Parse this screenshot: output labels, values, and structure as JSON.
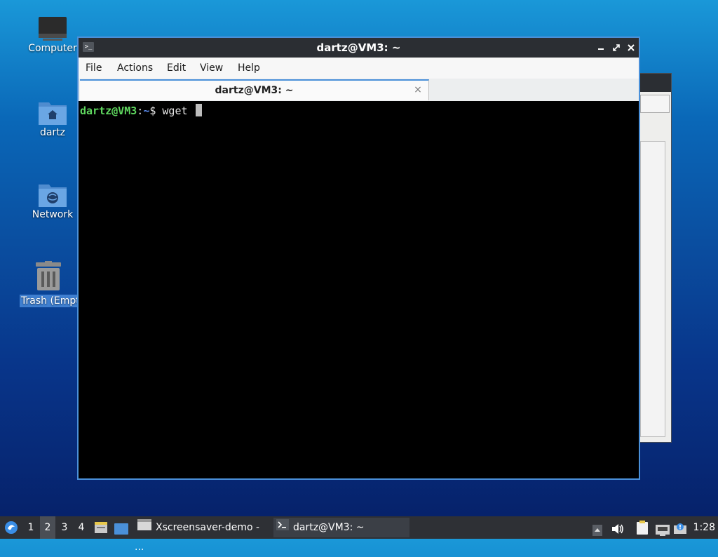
{
  "desktop": {
    "icons": [
      {
        "label": "Computer"
      },
      {
        "label": "dartz"
      },
      {
        "label": "Network"
      },
      {
        "label": "Trash (Empt"
      }
    ]
  },
  "window": {
    "title": "dartz@VM3: ~",
    "menu": [
      "File",
      "Actions",
      "Edit",
      "View",
      "Help"
    ],
    "tab": {
      "label": "dartz@VM3: ~"
    },
    "terminal": {
      "user_host": "dartz@VM3",
      "colon": ":",
      "path": "~",
      "symbol": "$",
      "command": "wget "
    }
  },
  "taskbar": {
    "workspaces": [
      "1",
      "2",
      "3",
      "4"
    ],
    "active_workspace": "2",
    "tasks": [
      {
        "label": "Xscreensaver-demo - ..."
      },
      {
        "label": "dartz@VM3: ~"
      }
    ],
    "clock": "1:28"
  },
  "colors": {
    "accent": "#4a90d9",
    "prompt_user": "#5fd75f",
    "prompt_path": "#5c8df0",
    "titlebar": "#2b2e33",
    "taskbar": "#2e3035"
  },
  "icons": [
    "computer-icon",
    "home-folder-icon",
    "network-folder-icon",
    "trash-icon",
    "terminal-icon",
    "minimize-icon",
    "maximize-icon",
    "close-icon",
    "start-menu-icon",
    "file-manager-icon",
    "show-desktop-icon",
    "volume-icon",
    "clipboard-icon",
    "network-status-icon",
    "notification-icon"
  ]
}
